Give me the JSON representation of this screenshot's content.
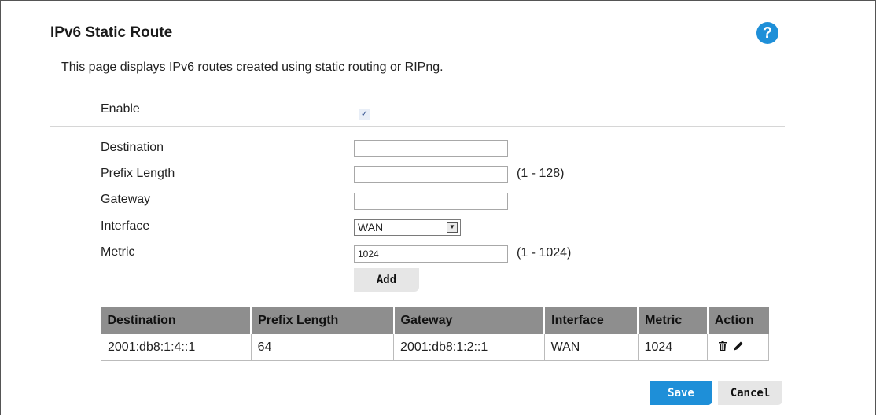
{
  "page": {
    "title": "IPv6 Static Route",
    "help_icon": "question-circle-icon",
    "description": "This page displays IPv6 routes created using static routing or RIPng."
  },
  "form": {
    "enable_label": "Enable",
    "enable_checked": true,
    "destination_label": "Destination",
    "destination_value": "",
    "prefix_length_label": "Prefix Length",
    "prefix_length_value": "",
    "prefix_length_range": "(1 - 128)",
    "gateway_label": "Gateway",
    "gateway_value": "",
    "interface_label": "Interface",
    "interface_selected": "WAN",
    "metric_label": "Metric",
    "metric_value": "1024",
    "metric_range": "(1 - 1024)",
    "add_label": "Add"
  },
  "table": {
    "headers": [
      "Destination",
      "Prefix Length",
      "Gateway",
      "Interface",
      "Metric",
      "Action"
    ],
    "rows": [
      {
        "destination": "2001:db8:1:4::1",
        "prefix_length": "64",
        "gateway": "2001:db8:1:2::1",
        "interface": "WAN",
        "metric": "1024",
        "actions": [
          "trash-icon",
          "pencil-icon"
        ]
      }
    ]
  },
  "footer": {
    "save_label": "Save",
    "cancel_label": "Cancel"
  },
  "colors": {
    "accent": "#1e8fd8",
    "table_header_bg": "#8e8e8e",
    "button_grey": "#e6e6e6"
  }
}
